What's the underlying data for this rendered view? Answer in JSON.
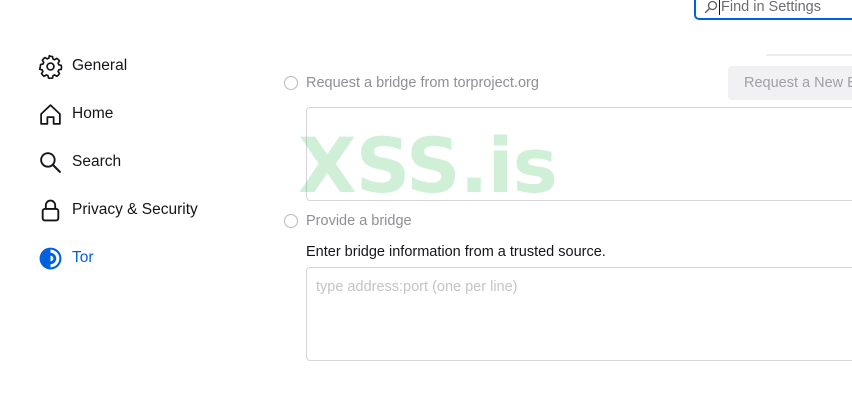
{
  "search": {
    "placeholder": "Find in Settings",
    "value": ""
  },
  "sidebar": {
    "items": [
      {
        "label": "General",
        "icon": "gear-icon",
        "active": false
      },
      {
        "label": "Home",
        "icon": "home-icon",
        "active": false
      },
      {
        "label": "Search",
        "icon": "search-icon",
        "active": false
      },
      {
        "label": "Privacy & Security",
        "icon": "lock-icon",
        "active": false
      },
      {
        "label": "Tor",
        "icon": "tor-onion-icon",
        "active": true
      }
    ]
  },
  "bridges": {
    "request_option_label": "Request a bridge from torproject.org",
    "request_button_label": "Request a New Bridge",
    "provide_option_label": "Provide a bridge",
    "provide_description": "Enter bridge information from a trusted source.",
    "provide_placeholder": "type address:port (one per line)",
    "provide_value": ""
  },
  "watermark": {
    "text": "XSS.is"
  },
  "colors": {
    "accent": "#0061e0",
    "text": "#15141a",
    "disabled_text": "#8f8f95",
    "watermark": "#2fb84e"
  }
}
